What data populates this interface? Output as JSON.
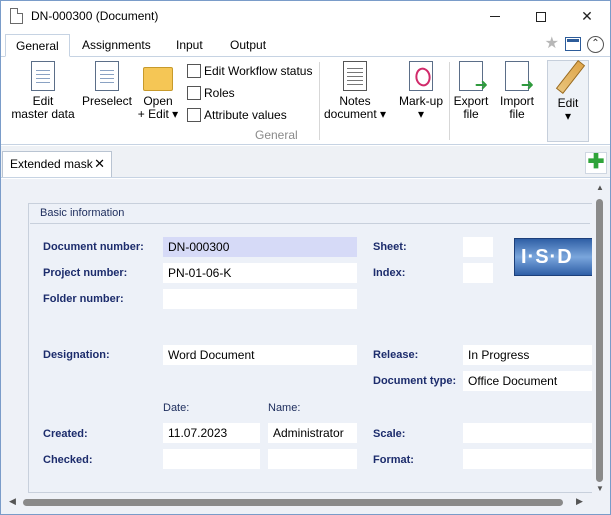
{
  "window": {
    "title": "DN-000300 (Document)"
  },
  "tabs": [
    {
      "label": "General"
    },
    {
      "label": "Assignments"
    },
    {
      "label": "Input"
    },
    {
      "label": "Output"
    }
  ],
  "ribbon": {
    "edit_master": "Edit\nmaster data",
    "preselect": "Preselect",
    "open_edit": "Open\n+ Edit ▾",
    "edit_workflow": "Edit Workflow status",
    "roles": "Roles",
    "attribute_values": "Attribute values",
    "group_label": "General",
    "notes": "Notes\ndocument ▾",
    "markup": "Mark-up\n▾",
    "export": "Export\nfile",
    "import": "Import\nfile",
    "edit": "Edit\n▾"
  },
  "mask": {
    "tab_label": "Extended mask",
    "close": "✕",
    "add": "✚"
  },
  "form": {
    "group_title": "Basic information",
    "labels": {
      "document_number": "Document number:",
      "project_number": "Project number:",
      "folder_number": "Folder number:",
      "designation": "Designation:",
      "created": "Created:",
      "checked": "Checked:",
      "sheet": "Sheet:",
      "index": "Index:",
      "release": "Release:",
      "document_type": "Document type:",
      "scale": "Scale:",
      "format": "Format:",
      "date": "Date:",
      "name": "Name:"
    },
    "values": {
      "document_number": "DN-000300",
      "project_number": "PN-01-06-K",
      "folder_number": "",
      "designation": "Word Document",
      "created_date": "11.07.2023",
      "created_name": "Administrator",
      "checked_date": "",
      "checked_name": "",
      "sheet": "",
      "index": "",
      "release": "In Progress",
      "document_type": "Office Document",
      "scale": "",
      "format": ""
    },
    "logo_text": "I·S·D"
  }
}
